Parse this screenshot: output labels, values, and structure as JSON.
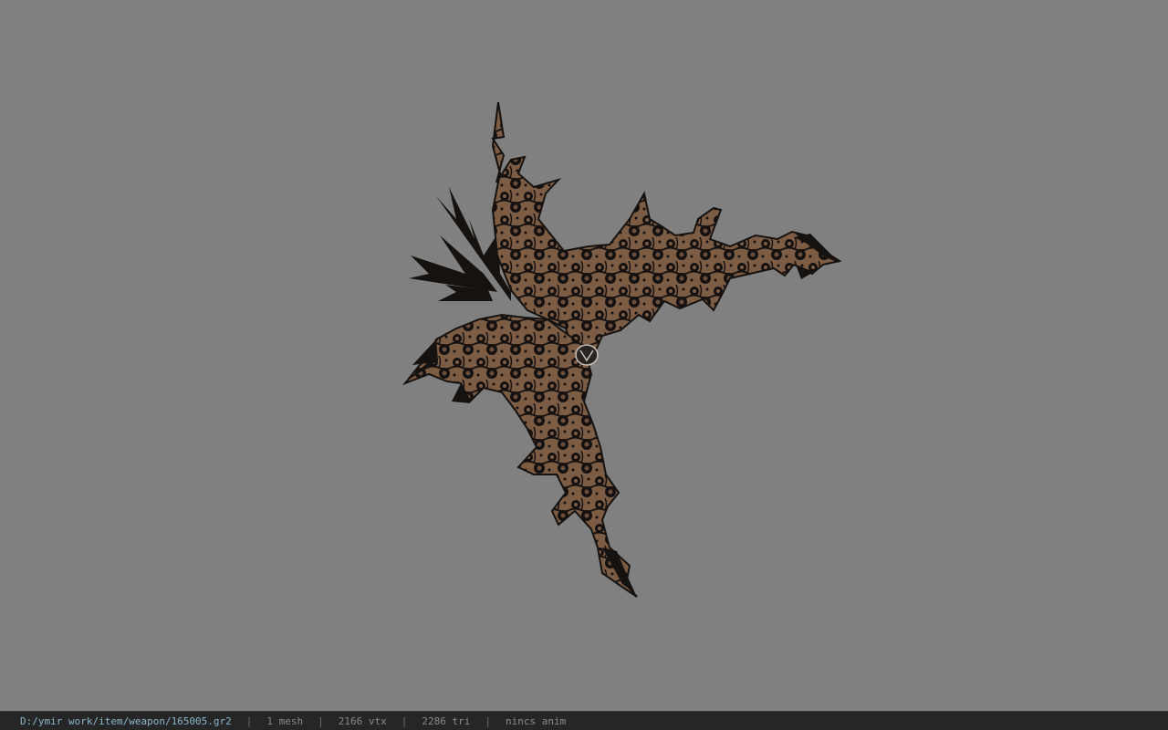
{
  "viewport": {
    "background_color": "#808080",
    "model": {
      "description_icon": "bat-wing-weapon-model",
      "body_color": "#7a5a42",
      "lace_color": "#151210"
    }
  },
  "status_bar": {
    "file_path": "D:/ymir work/item/weapon/165005.gr2",
    "separator": "|",
    "mesh_count": "1 mesh",
    "vertex_count": "2166 vtx",
    "triangle_count": "2286 tri",
    "anim_status": "nincs anim",
    "path_color": "#8ab7c9"
  }
}
